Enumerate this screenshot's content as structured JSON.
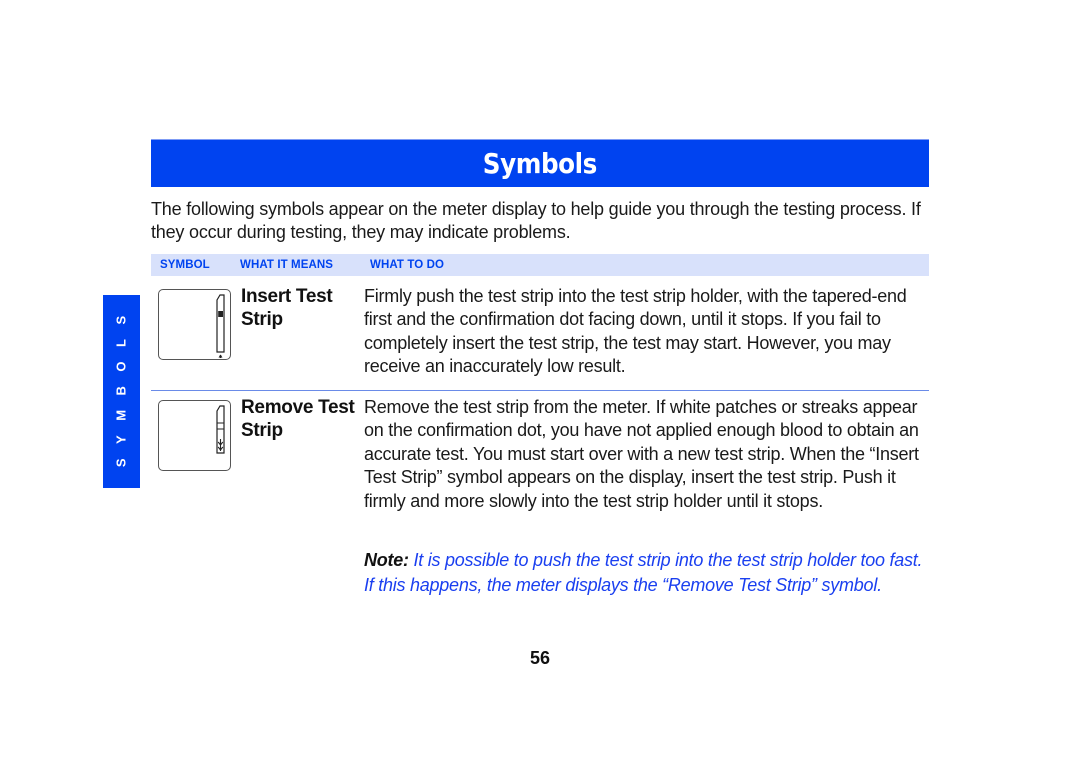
{
  "page": {
    "title": "Symbols",
    "side_tab": "SYMBOLS",
    "intro": "The following symbols appear on the meter display to help guide you through the testing process. If they occur during testing, they may indicate problems.",
    "page_number": "56"
  },
  "table": {
    "headers": {
      "symbol": "SYMBOL",
      "means": "WHAT IT MEANS",
      "todo": "WHAT TO DO"
    },
    "rows": [
      {
        "symbol_icon": "insert-test-strip-icon",
        "means": "Insert Test Strip",
        "todo": "Firmly push the test strip into the test strip holder, with the tapered-end first and the confirmation dot facing down, until it stops. If you fail to completely insert the test strip, the test may start. However, you may receive an inaccurately low result."
      },
      {
        "symbol_icon": "remove-test-strip-icon",
        "means": "Remove Test Strip",
        "todo": "Remove the test strip from the meter. If white patches or streaks appear on the confirmation dot, you have not applied enough blood to obtain an accurate test. You must start over with a new test strip. When the “Insert Test Strip” symbol appears on the display, insert the test strip. Push it firmly and more slowly into the test strip holder until it stops."
      }
    ]
  },
  "note": {
    "label": "Note:",
    "text": " It is possible to push the test strip into the test strip holder too fast. If this happens, the meter displays the “Remove Test Strip” symbol."
  },
  "colors": {
    "accent_blue": "#0043f0",
    "header_band": "#d8e1fb",
    "note_text": "#1a3ff0"
  }
}
